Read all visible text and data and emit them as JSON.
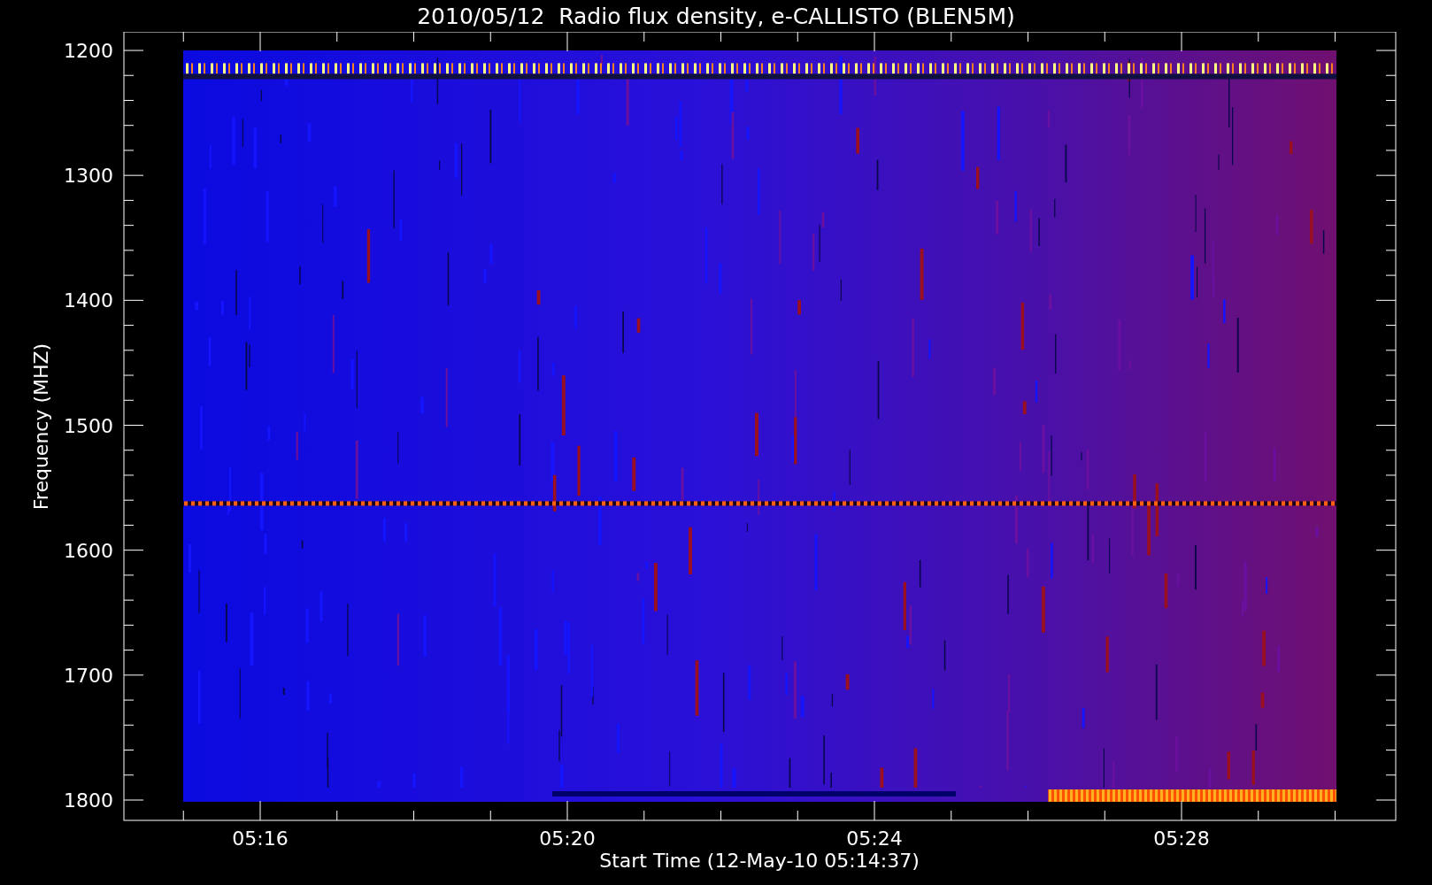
{
  "title": "2010/05/12  Radio flux density, e-CALLISTO (BLEN5M)",
  "y_axis": {
    "label": "Frequency (MHZ)",
    "ticks": [
      "1200",
      "1300",
      "1400",
      "1500",
      "1600",
      "1700",
      "1800"
    ]
  },
  "x_axis": {
    "label": "Start Time (12-May-10 05:14:37)",
    "ticks": [
      "05:16",
      "05:20",
      "05:24",
      "05:28"
    ]
  }
}
